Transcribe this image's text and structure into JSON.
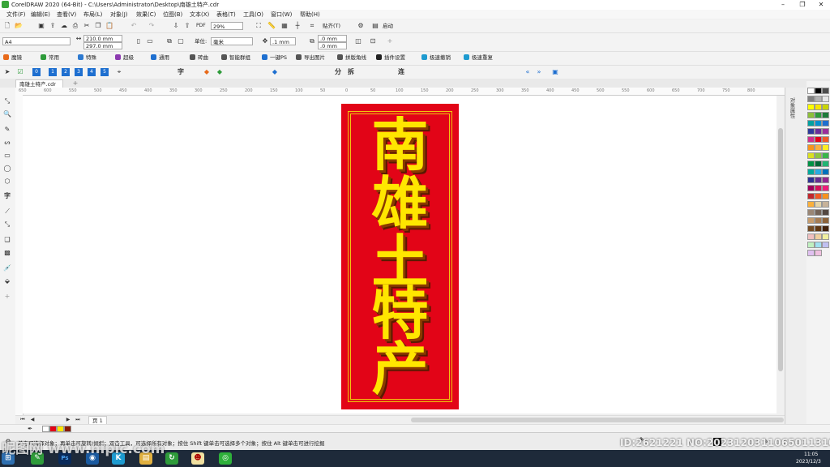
{
  "window": {
    "title": "CorelDRAW 2020 (64-Bit) - C:\\Users\\Administrator\\Desktop\\南雄土特产.cdr",
    "min": "–",
    "max": "❐",
    "close": "✕"
  },
  "menubar": [
    "文件(F)",
    "编辑(E)",
    "查看(V)",
    "布局(L)",
    "对象(J)",
    "效果(C)",
    "位图(B)",
    "文本(X)",
    "表格(T)",
    "工具(O)",
    "窗口(W)",
    "帮助(H)"
  ],
  "standard_toolbar": {
    "zoom": "29%",
    "snap_label": "贴齐(T)",
    "launch_label": "启动"
  },
  "property_bar": {
    "page_size": "A4",
    "width": "210.0 mm",
    "height": "297.0 mm",
    "units_label": "单位:",
    "units_value": "毫米",
    "nudge": ".1 mm",
    "dup_x": ".0 mm",
    "dup_y": ".0 mm"
  },
  "plugin_bar": [
    {
      "label": "魔镜",
      "color": "#e86a1a"
    },
    {
      "label": "常用",
      "color": "#2e9b3a"
    },
    {
      "label": "特殊",
      "color": "#2e7ad0"
    },
    {
      "label": "超级",
      "color": "#8c3ab0"
    },
    {
      "label": "通用",
      "color": "#1e6fd0"
    },
    {
      "label": "砖曲",
      "color": "#555555"
    },
    {
      "label": "智能群组",
      "color": "#555555"
    },
    {
      "label": "一键PS",
      "color": "#1e6fd0"
    },
    {
      "label": "导出图片",
      "color": "#555555"
    },
    {
      "label": "拼版角线",
      "color": "#555555"
    },
    {
      "label": "插件设置",
      "color": "#222222"
    },
    {
      "label": "极速撤销",
      "color": "#1e9bd0"
    },
    {
      "label": "极速重复",
      "color": "#1e9bd0"
    }
  ],
  "doc_tab": {
    "label": "南雄土特产.cdr",
    "add": "+"
  },
  "ruler_h": [
    "650",
    "600",
    "550",
    "500",
    "450",
    "400",
    "350",
    "300",
    "250",
    "200",
    "150",
    "100",
    "50",
    "0",
    "50",
    "100",
    "150",
    "200",
    "250",
    "300",
    "350",
    "400",
    "450",
    "500",
    "550",
    "600",
    "650",
    "700",
    "750",
    "800"
  ],
  "banner": {
    "chars": [
      "南",
      "雄",
      "土",
      "特",
      "产"
    ],
    "bg": "#e20417",
    "text": "#ffe600",
    "shadow": "#8a3a00"
  },
  "dock_tab": "对象属性",
  "page_nav": {
    "page_label": "页 1"
  },
  "status": {
    "text": "单击可选择对象；再单击可旋转/倾斜；双击工具，可选择所有对象；按住 Shift 键单击可选择多个对象；按住 Alt 键单击可进行挖掘"
  },
  "watermark": {
    "left": "昵图网 www.nipic.com",
    "id": "ID:2621221 NO:20231203110650113102"
  },
  "taskbar": {
    "time": "11:05",
    "date": "2023/12/3"
  },
  "palette_colors": [
    "#ffffff",
    "#000000",
    "#4d4d4d",
    "#808080",
    "#b3b3b3",
    "#e6e6e6",
    "#ffff00",
    "#f7e600",
    "#c8d400",
    "#8dbf3a",
    "#2e9b3a",
    "#1e7a3a",
    "#00a0a0",
    "#0090d0",
    "#1e6fd0",
    "#2e3a9b",
    "#6a2e9b",
    "#9b2e9b",
    "#d02e8d",
    "#e2041b",
    "#f05a28",
    "#f7941d",
    "#fbb040",
    "#fcee21",
    "#d9e021",
    "#8cc63f",
    "#39b54a",
    "#009245",
    "#006837",
    "#22b573",
    "#00a99d",
    "#29abe2",
    "#0071bc",
    "#2e3192",
    "#662d91",
    "#93278f",
    "#9e005d",
    "#d4145a",
    "#ed1e79",
    "#c1272d",
    "#f15a24",
    "#f7931e",
    "#fbb03b",
    "#e6d5a8",
    "#c7b299",
    "#998675",
    "#736357",
    "#534741",
    "#c69c6d",
    "#a67c52",
    "#8c6239",
    "#754c24",
    "#603813",
    "#42210b",
    "#f0c0c0",
    "#f0d0a0",
    "#f0f0a0",
    "#c0f0c0",
    "#a0e0f0",
    "#c0c0f0",
    "#e0c0f0",
    "#f0c0e0"
  ]
}
